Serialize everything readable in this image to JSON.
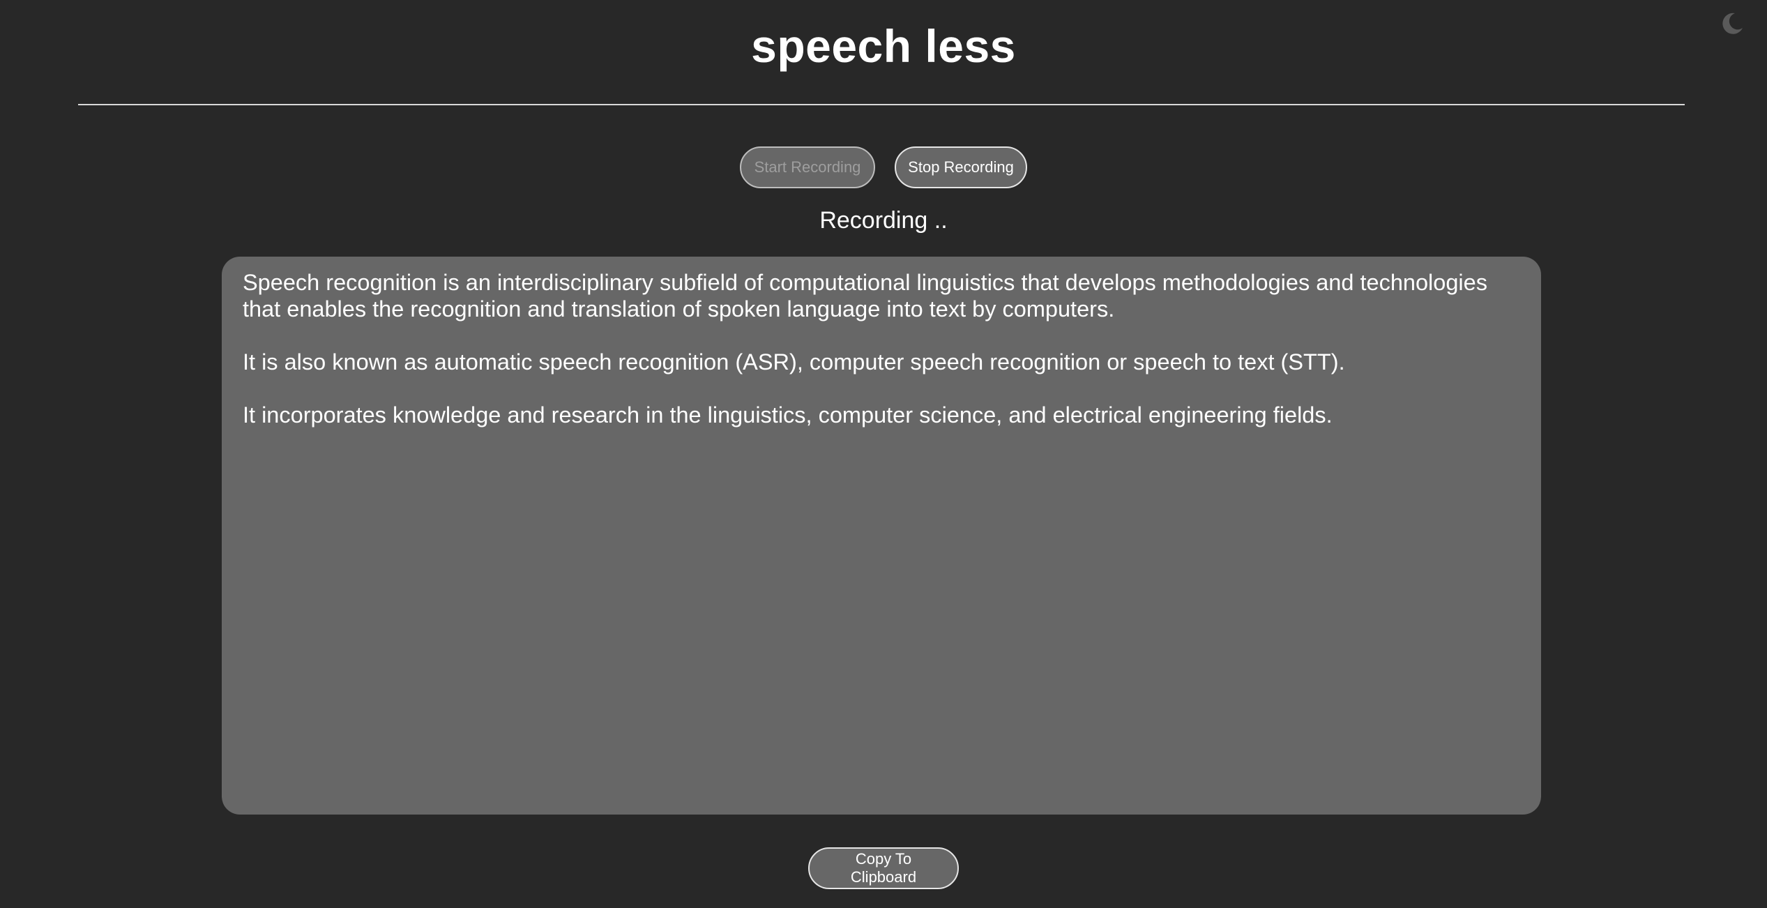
{
  "app": {
    "title": "speech less"
  },
  "theme_toggle": {
    "icon": "moon-icon"
  },
  "controls": {
    "start_label": "Start Recording",
    "stop_label": "Stop Recording"
  },
  "status": {
    "text": "Recording .."
  },
  "transcript": {
    "paragraphs": [
      "Speech recognition is an interdisciplinary subfield of computational linguistics that develops methodologies and technologies that enables the recognition and translation of spoken language into text by computers.",
      "It is also known as automatic speech recognition (ASR), computer speech recognition or speech to text (STT).",
      "It incorporates knowledge and research in the linguistics, computer science, and electrical engineering fields."
    ]
  },
  "actions": {
    "copy_label": "Copy To Clipboard"
  },
  "colors": {
    "background": "#282828",
    "panel": "#676767",
    "text": "#ffffff",
    "disabled_text": "#9e9e9e"
  }
}
